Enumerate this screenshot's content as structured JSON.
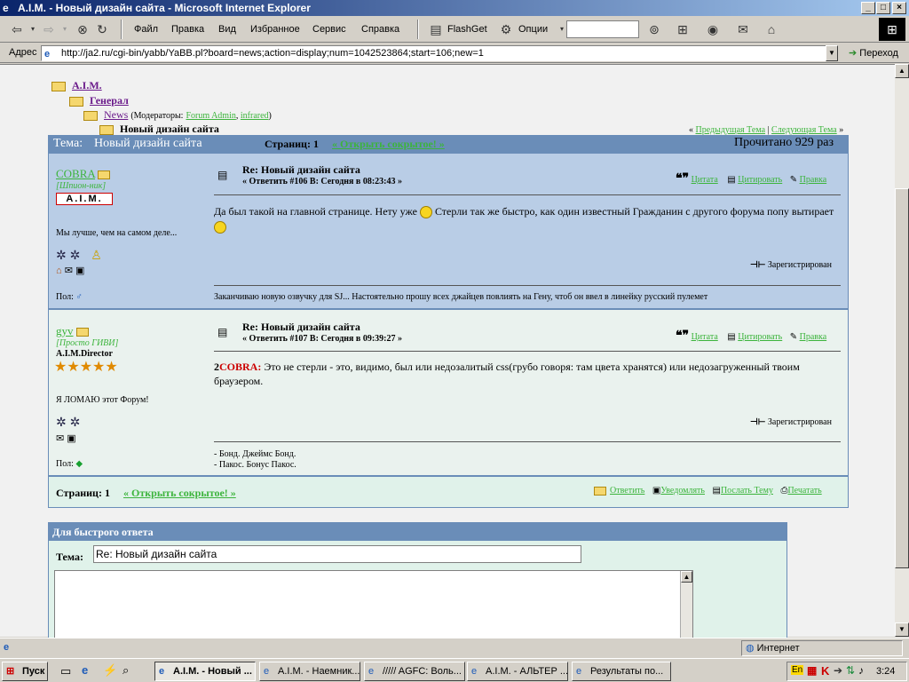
{
  "window": {
    "title": "A.I.M. - Новый дизайн сайта - Microsoft Internet Explorer"
  },
  "menu": {
    "items": [
      "Файл",
      "Правка",
      "Вид",
      "Избранное",
      "Сервис",
      "Справка"
    ],
    "flashget": "FlashGet",
    "options": "Опции"
  },
  "address": {
    "label": "Адрес",
    "url": "http://ja2.ru/cgi-bin/yabb/YaBB.pl?board=news;action=display;num=1042523864;start=106;new=1",
    "go": "Переход"
  },
  "breadcrumb": {
    "level1": "A.I.M.",
    "level2": "Генерал",
    "level3": "News",
    "moderators_prefix": "(Модераторы:",
    "mod1": "Forum Admin",
    "mod2": "infrared",
    "moderators_suffix": ")",
    "current": "Новый дизайн сайта"
  },
  "thread_nav": {
    "prev": "Предыдущая Тема",
    "sep": "|",
    "next": "Следующая Тема"
  },
  "thread_header": {
    "topic_label": "Тема:",
    "topic": "Новый дизайн сайта",
    "pages_label": "Страниц: 1",
    "open_hidden": "« Открыть сокрытое! »",
    "read_count": "Прочитано 929 раз"
  },
  "posts": [
    {
      "author": "COBRA",
      "group": "[Шпион-ник]",
      "badge": "A.I.M.",
      "tagline": "Мы лучше, чем на самом деле...",
      "gender_label": "Пол:",
      "subject": "Re: Новый дизайн сайта",
      "meta": "« Ответить #106 В: Сегодня в 08:23:43 »",
      "quote": "Цитата",
      "cite": "Цитировать",
      "edit": "Правка",
      "body_part1": "Да был такой на главной странице. Нету уже",
      "body_part2": "Стерли так же быстро, как один известный Гражданин с другого форума попу вытирает",
      "registered": "Зарегистрирован",
      "signature": "Заканчиваю новую озвучку для SJ... Настоятельно прошу всех джайцев повлиять на Гену, чтоб он ввел в линейку русский пулемет"
    },
    {
      "author": "gyv",
      "group": "[Просто ГИВИ]",
      "role": "A.I.M.Director",
      "tagline": "Я ЛОМАЮ этот Форум!",
      "gender_label": "Пол:",
      "subject": "Re: Новый дизайн сайта",
      "meta": "« Ответить #107 В: Сегодня в 09:39:27 »",
      "quote": "Цитата",
      "cite": "Цитировать",
      "edit": "Правка",
      "body_prefix": "2",
      "body_addressee": "COBRA:",
      "body_text": "Это не стерли - это, видимо, был или недозалитый css(грубо говоря: там цвета хранятся) или недозагруженный твоим браузером.",
      "registered": "Зарегистрирован",
      "signature_line1": "- Бонд. Джеймс Бонд.",
      "signature_line2": "- Пакос. Бонус Пакос."
    }
  ],
  "footer_bar": {
    "pages_label": "Страниц: 1",
    "open_hidden": "« Открыть сокрытое! »",
    "reply": "Ответить",
    "notify": "Уведомлять",
    "send_topic": "Послать Тему",
    "print": "Печатать"
  },
  "quick_reply": {
    "header": "Для быстрого ответа",
    "subject_label": "Тема:",
    "subject_value": "Re: Новый дизайн сайта"
  },
  "statusbar": {
    "zone": "Интернет"
  },
  "taskbar": {
    "start": "Пуск",
    "tasks": [
      "A.I.M. - Новый ...",
      "A.I.M. - Наемник...",
      "///// AGFC: Воль...",
      "A.I.M. - АЛЬТЕР ...",
      "Результаты по..."
    ],
    "lang": "En",
    "clock": "3:24"
  },
  "colors": {
    "link": "#3cb43c",
    "header_blue": "#6a8db8",
    "post1_bg": "#b9cde6",
    "post2_bg": "#eaf2ee"
  }
}
